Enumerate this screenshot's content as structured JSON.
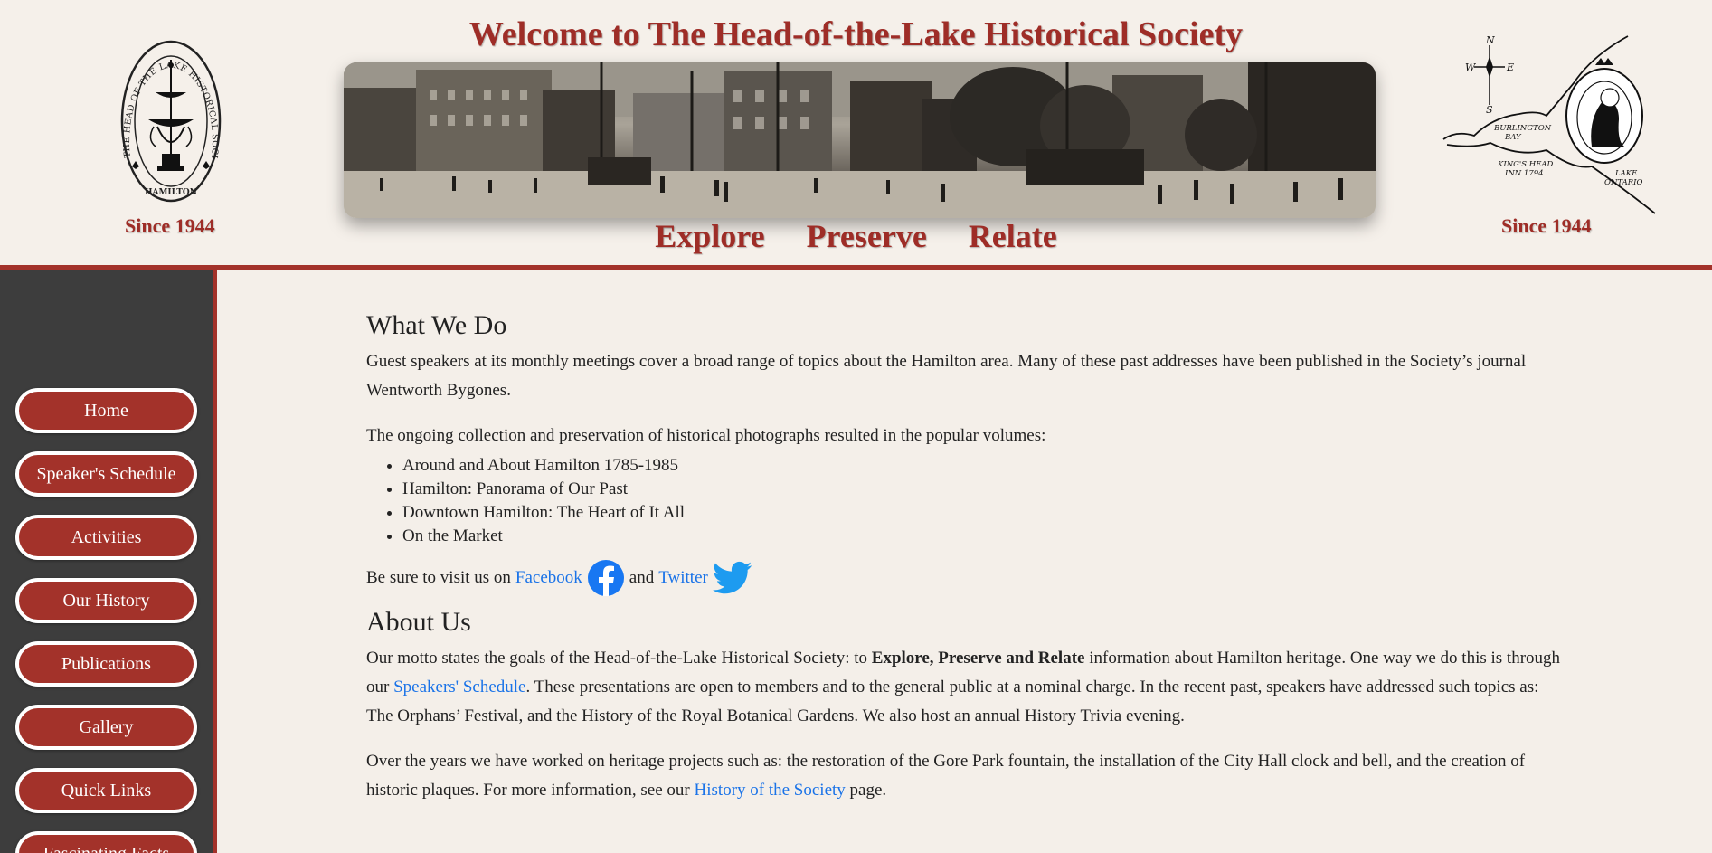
{
  "header": {
    "title": "Welcome to The Head-of-the-Lake Historical Society",
    "since_left": "Since 1944",
    "since_right": "Since 1944",
    "motto": [
      "Explore",
      "Preserve",
      "Relate"
    ],
    "seal_text": "THE HEAD OF THE LAKE HISTORICAL SOCIETY · HAMILTON",
    "map_labels": {
      "compass_n": "N",
      "compass_s": "S",
      "compass_e": "E",
      "compass_w": "W",
      "burlington": "BURLINGTON",
      "bay": "BAY",
      "kings_head": "KING'S HEAD",
      "inn": "INN 1794",
      "lake": "LAKE",
      "ontario": "ONTARIO"
    }
  },
  "sidebar": {
    "items": [
      {
        "label": "Home"
      },
      {
        "label": "Speaker's Schedule"
      },
      {
        "label": "Activities"
      },
      {
        "label": "Our History"
      },
      {
        "label": "Publications"
      },
      {
        "label": "Gallery"
      },
      {
        "label": "Quick Links"
      },
      {
        "label": "Fascinating Facts"
      }
    ]
  },
  "main": {
    "what_we_do": {
      "heading": "What We Do",
      "p1": "Guest speakers at its monthly meetings cover a broad range of topics about the Hamilton area. Many of these past addresses have been published in the Society’s journal Wentworth Bygones.",
      "p2": "The ongoing collection and preservation of historical photographs resulted in the popular volumes:",
      "volumes": [
        "Around and About Hamilton 1785-1985",
        "Hamilton: Panorama of Our Past",
        "Downtown Hamilton: The Heart of It All",
        "On the Market"
      ],
      "social_prefix": "Be sure to visit us on",
      "facebook": "Facebook",
      "and": "and",
      "twitter": "Twitter"
    },
    "about_us": {
      "heading": "About Us",
      "p1_a": "Our motto states the goals of the Head-of-the-Lake Historical Society: to ",
      "p1_bold": "Explore, Preserve and Relate",
      "p1_b": " information about Hamilton heritage. One way we do this is through our ",
      "p1_link": "Speakers' Schedule",
      "p1_c": ". These presentations are open to members and to the general public at a nominal charge. In the recent past, speakers have addressed such topics as: The Orphans’ Festival, and the History of the Royal Botanical Gardens. We also host an annual History Trivia evening.",
      "p2_a": "Over the years we have worked on heritage projects such as: the restoration of the Gore Park fountain, the installation of the City Hall clock and bell, and the creation of historic plaques. For more information, see our ",
      "p2_link": "History of the Society",
      "p2_b": " page."
    }
  },
  "colors": {
    "brand_red": "#a3322a",
    "title_red": "#9e2d27",
    "sidebar_bg": "#3d3d3d",
    "link_blue": "#1a73e8",
    "facebook_blue": "#1877f2",
    "twitter_blue": "#1d9bf0"
  },
  "icons": [
    "seal-logo",
    "map-illustration",
    "panorama-photo",
    "facebook-icon",
    "twitter-icon"
  ]
}
